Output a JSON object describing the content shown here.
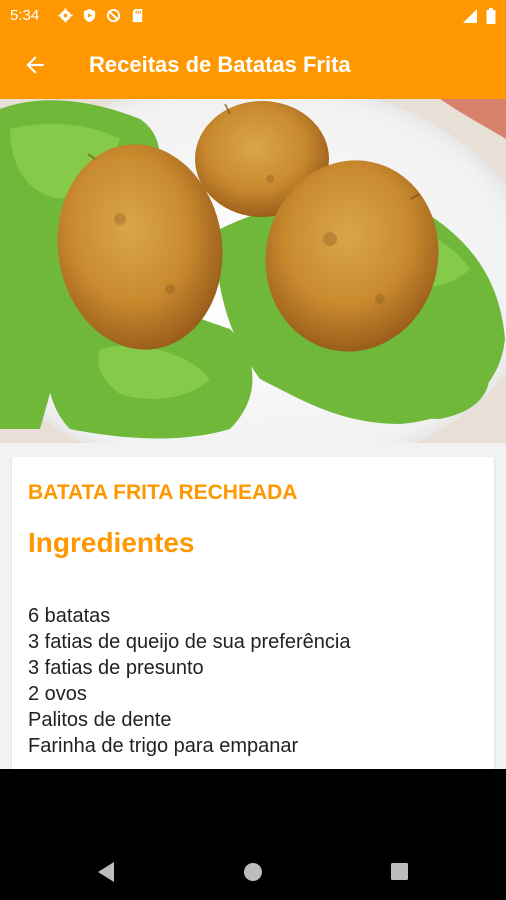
{
  "status_bar": {
    "time": "5:34",
    "icons": [
      "settings-icon",
      "play-protect-icon",
      "sync-off-icon",
      "sd-card-icon"
    ],
    "right_icons": [
      "signal-icon",
      "battery-icon"
    ]
  },
  "app_bar": {
    "title": "Receitas de Batatas Frita",
    "back_icon": "arrow-back-icon"
  },
  "hero_image": {
    "description_icon": "recipe-photo"
  },
  "recipe": {
    "name": "BATATA FRITA RECHEADA",
    "section_title": "Ingredientes",
    "ingredients": [
      "6 batatas",
      "3 fatias de queijo de sua preferência",
      "3 fatias de presunto",
      "2 ovos",
      "Palitos de dente",
      "Farinha de trigo para empanar"
    ]
  },
  "nav_bar": {
    "buttons": [
      "back-nav-icon",
      "home-nav-icon",
      "recents-nav-icon"
    ]
  },
  "colors": {
    "accent": "#ff9800",
    "text": "#222222",
    "background": "#f2f2f2"
  }
}
